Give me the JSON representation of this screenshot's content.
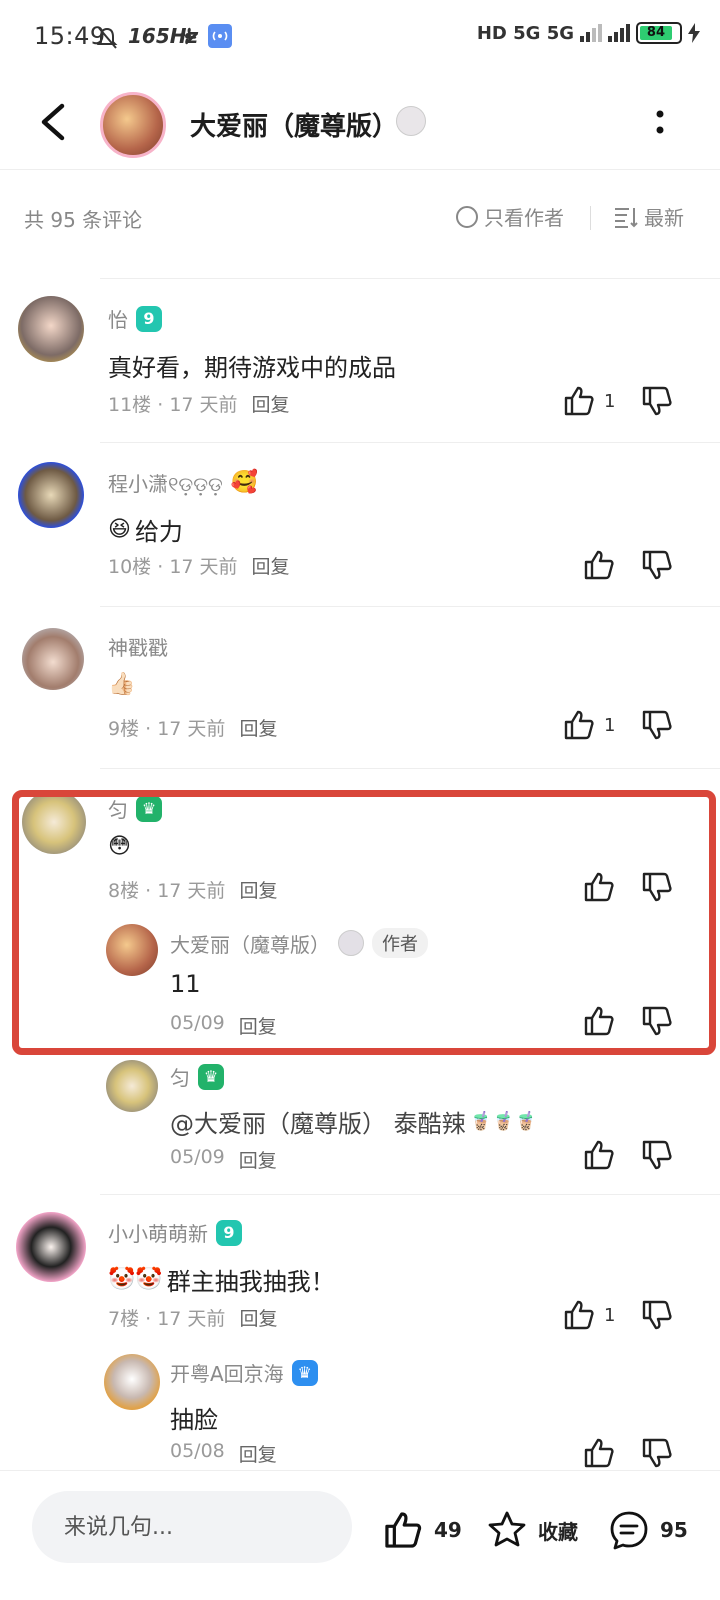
{
  "status_bar": {
    "time": "15:49",
    "refresh_rate": "165Hz",
    "network": "HD 5G 5G",
    "battery": "84"
  },
  "header": {
    "title": "大爱丽（魔尊版）"
  },
  "sort_bar": {
    "count_text": "共 95 条评论",
    "only_author": "只看作者",
    "sort_label": "最新"
  },
  "comments": [
    {
      "user": "怡",
      "level": "9",
      "text": "真好看，期待游戏中的成品",
      "floor": "11楼",
      "time": "17 天前",
      "reply": "回复",
      "likes": "1"
    },
    {
      "user": "程小潇୧ଡ଼ଡ଼ଡ଼",
      "text": "给力",
      "floor": "10楼",
      "time": "17 天前",
      "reply": "回复",
      "likes": ""
    },
    {
      "user": "神戳戳",
      "text": "👍🏻",
      "floor": "9楼",
      "time": "17 天前",
      "reply": "回复",
      "likes": "1"
    },
    {
      "user": "匀",
      "text": "😳",
      "floor": "8楼",
      "time": "17 天前",
      "reply": "回复",
      "likes": "",
      "replies": [
        {
          "user": "大爱丽（魔尊版）",
          "tag": "作者",
          "text": "11",
          "time": "05/09",
          "reply": "回复"
        },
        {
          "user": "匀",
          "text": "@大爱丽（魔尊版） 泰酷辣",
          "time": "05/09",
          "reply": "回复"
        }
      ]
    },
    {
      "user": "小小萌萌新",
      "level": "9",
      "text": "群主抽我抽我！",
      "floor": "7楼",
      "time": "17 天前",
      "reply": "回复",
      "likes": "1",
      "replies": [
        {
          "user": "开粤A回京海",
          "text": "抽脸",
          "time": "05/08",
          "reply": "回复"
        }
      ]
    }
  ],
  "bottom_bar": {
    "input_placeholder": "来说几句...",
    "like_count": "49",
    "favorite_label": "收藏",
    "comment_count": "95"
  },
  "colors": {
    "highlight": "#d9463a",
    "level_teal": "#23c6b0",
    "level_green": "#22b26a",
    "level_blue": "#2d8ff0"
  }
}
